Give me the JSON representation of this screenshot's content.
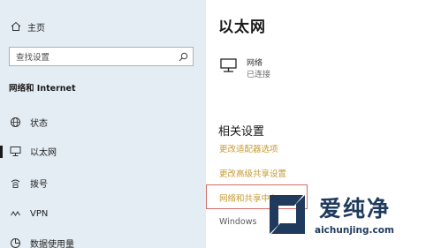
{
  "sidebar": {
    "home_label": "主页",
    "search_placeholder": "查找设置",
    "section_title": "网络和 Internet",
    "items": [
      {
        "label": "状态",
        "icon": "globe-icon"
      },
      {
        "label": "以太网",
        "icon": "ethernet-icon",
        "selected": true
      },
      {
        "label": "拨号",
        "icon": "dialup-icon"
      },
      {
        "label": "VPN",
        "icon": "vpn-icon"
      },
      {
        "label": "数据使用量",
        "icon": "data-usage-icon"
      }
    ]
  },
  "main": {
    "title": "以太网",
    "network": {
      "name": "网络",
      "status": "已连接"
    },
    "related_title": "相关设置",
    "links": [
      "更改适配器选项",
      "更改高级共享设置",
      "网络和共享中心",
      "Windows"
    ]
  },
  "watermark": {
    "brand": "爱纯净",
    "url": "aichunjing.com"
  },
  "colors": {
    "sidebar_bg": "#e4edf4",
    "link": "#c79a32",
    "highlight": "#d26b63",
    "watermark": "#1f3a5c"
  }
}
